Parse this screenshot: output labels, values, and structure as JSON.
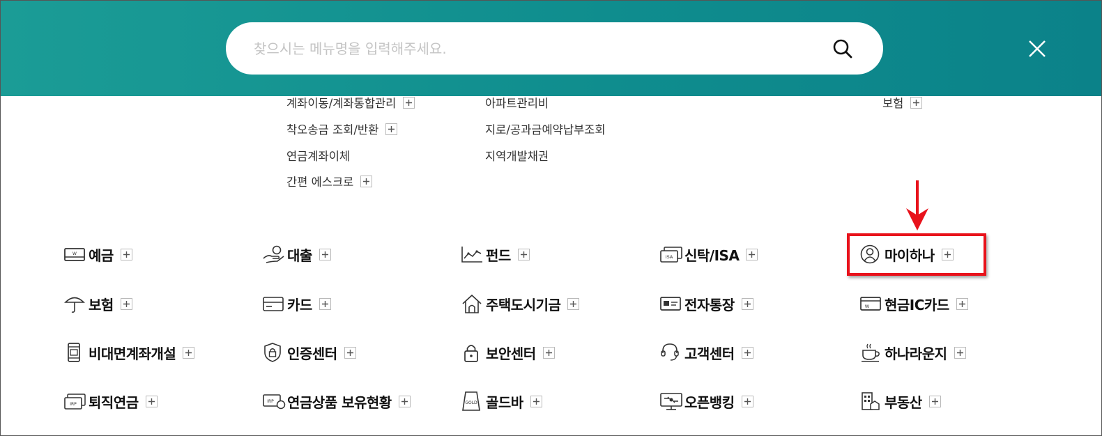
{
  "search": {
    "placeholder": "찾으시는 메뉴명을 입력해주세요."
  },
  "submenus": [
    {
      "label": "계좌이동/계좌통합관리",
      "has_plus": true
    },
    {
      "label": "착오송금 조회/반환",
      "has_plus": true
    },
    {
      "label": "연금계좌이체",
      "has_plus": false
    },
    {
      "label": "간편 에스크로",
      "has_plus": true
    },
    {
      "label": "아파트관리비",
      "has_plus": false
    },
    {
      "label": "지로/공과금예약납부조회",
      "has_plus": false
    },
    {
      "label": "지역개발채권",
      "has_plus": false
    },
    {
      "label": "보험",
      "has_plus": true
    }
  ],
  "categories": [
    {
      "label": "예금",
      "icon": "passbook-icon"
    },
    {
      "label": "대출",
      "icon": "hand-coin-icon"
    },
    {
      "label": "펀드",
      "icon": "line-chart-icon"
    },
    {
      "label": "신탁/ISA",
      "icon": "isa-card-icon"
    },
    {
      "label": "마이하나",
      "icon": "user-profile-icon"
    },
    {
      "label": "보험",
      "icon": "umbrella-icon"
    },
    {
      "label": "카드",
      "icon": "credit-card-icon"
    },
    {
      "label": "주택도시기금",
      "icon": "house-icon"
    },
    {
      "label": "전자통장",
      "icon": "e-passbook-icon"
    },
    {
      "label": "현금IC카드",
      "icon": "ic-card-icon"
    },
    {
      "label": "비대면계좌개설",
      "icon": "mobile-phone-icon"
    },
    {
      "label": "인증센터",
      "icon": "shield-lock-icon"
    },
    {
      "label": "보안센터",
      "icon": "padlock-icon"
    },
    {
      "label": "고객센터",
      "icon": "headset-icon"
    },
    {
      "label": "하나라운지",
      "icon": "coffee-cup-icon"
    },
    {
      "label": "퇴직연금",
      "icon": "irp-card-icon"
    },
    {
      "label": "연금상품 보유현황",
      "icon": "irp-coin-icon"
    },
    {
      "label": "골드바",
      "icon": "gold-bar-icon"
    },
    {
      "label": "오픈뱅킹",
      "icon": "open-banking-icon"
    },
    {
      "label": "부동산",
      "icon": "building-icon"
    }
  ],
  "highlighted": "마이하나",
  "colors": {
    "header": "#0f8d8e",
    "highlight": "#e8121b"
  }
}
